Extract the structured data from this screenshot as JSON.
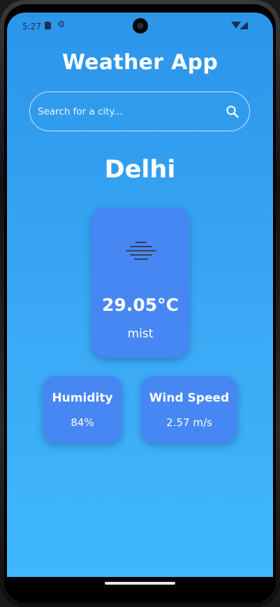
{
  "status_bar": {
    "time": "5:27",
    "icons": [
      "sd-card-icon",
      "gear-icon",
      "wifi-icon",
      "signal-icon"
    ]
  },
  "app": {
    "title": "Weather App"
  },
  "search": {
    "placeholder": "Search for a city...",
    "value": ""
  },
  "weather": {
    "city": "Delhi",
    "icon": "mist-icon",
    "temperature": "29.05°C",
    "condition": "mist"
  },
  "stats": {
    "humidity_label": "Humidity",
    "humidity_value": "84%",
    "wind_label": "Wind Speed",
    "wind_value": "2.57 m/s"
  },
  "colors": {
    "background_top": "#2b95ea",
    "background_bottom": "#3fb9fd",
    "card": "#4787f3",
    "text": "#ffffff"
  }
}
